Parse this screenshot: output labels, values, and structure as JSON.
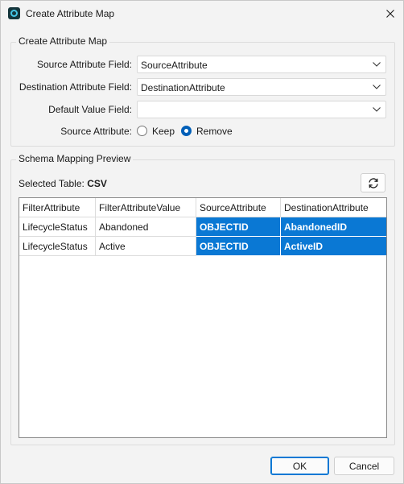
{
  "window": {
    "title": "Create Attribute Map"
  },
  "map_group": {
    "legend": "Create Attribute Map",
    "source_field": {
      "label": "Source Attribute Field:",
      "value": "SourceAttribute"
    },
    "destination_field": {
      "label": "Destination Attribute Field:",
      "value": "DestinationAttribute"
    },
    "default_field": {
      "label": "Default Value Field:",
      "value": ""
    },
    "source_attribute": {
      "label": "Source Attribute:",
      "options": [
        {
          "label": "Keep",
          "checked": false
        },
        {
          "label": "Remove",
          "checked": true
        }
      ]
    }
  },
  "preview_group": {
    "legend": "Schema Mapping Preview",
    "selected_table_label": "Selected Table:",
    "selected_table_value": "CSV",
    "columns": [
      "FilterAttribute",
      "FilterAttributeValue",
      "SourceAttribute",
      "DestinationAttribute"
    ],
    "rows": [
      [
        "LifecycleStatus",
        "Abandoned",
        "OBJECTID",
        "AbandonedID"
      ],
      [
        "LifecycleStatus",
        "Active",
        "OBJECTID",
        "ActiveID"
      ]
    ]
  },
  "buttons": {
    "ok": "OK",
    "cancel": "Cancel"
  },
  "icons": {
    "app": "app-icon",
    "close": "close-icon",
    "chevron": "chevron-down-icon",
    "refresh": "refresh-icon"
  },
  "colors": {
    "accent": "#0a78d4",
    "selection": "#0a78d4",
    "background": "#f3f3f3"
  }
}
